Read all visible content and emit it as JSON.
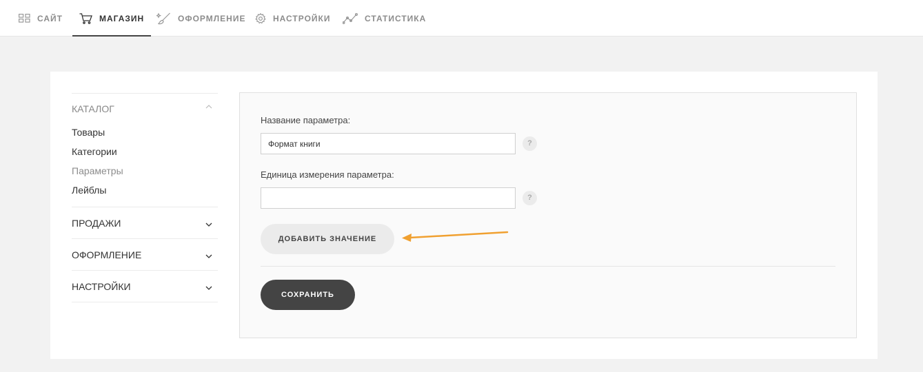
{
  "topnav": {
    "items": [
      {
        "label": "САЙТ",
        "icon": "grid-icon"
      },
      {
        "label": "МАГАЗИН",
        "icon": "cart-icon",
        "active": true
      },
      {
        "label": "ОФОРМЛЕНИЕ",
        "icon": "brush-icon"
      },
      {
        "label": "НАСТРОЙКИ",
        "icon": "gear-icon"
      },
      {
        "label": "СТАТИСТИКА",
        "icon": "stats-icon"
      }
    ]
  },
  "sidebar": {
    "catalog": {
      "title": "КАТАЛОГ",
      "items": [
        {
          "label": "Товары"
        },
        {
          "label": "Категории"
        },
        {
          "label": "Параметры",
          "active": true
        },
        {
          "label": "Лейблы"
        }
      ]
    },
    "sections": [
      {
        "label": "ПРОДАЖИ"
      },
      {
        "label": "ОФОРМЛЕНИЕ"
      },
      {
        "label": "НАСТРОЙКИ"
      }
    ]
  },
  "form": {
    "name_label": "Название параметра:",
    "name_value": "Формат книги",
    "unit_label": "Единица измерения параметра:",
    "unit_value": "",
    "help_glyph": "?",
    "add_value_button": "ДОБАВИТЬ ЗНАЧЕНИЕ",
    "save_button": "СОХРАНИТЬ"
  },
  "colors": {
    "accent_arrow": "#f0a030",
    "primary_button": "#444444",
    "secondary_button": "#ebebeb"
  }
}
